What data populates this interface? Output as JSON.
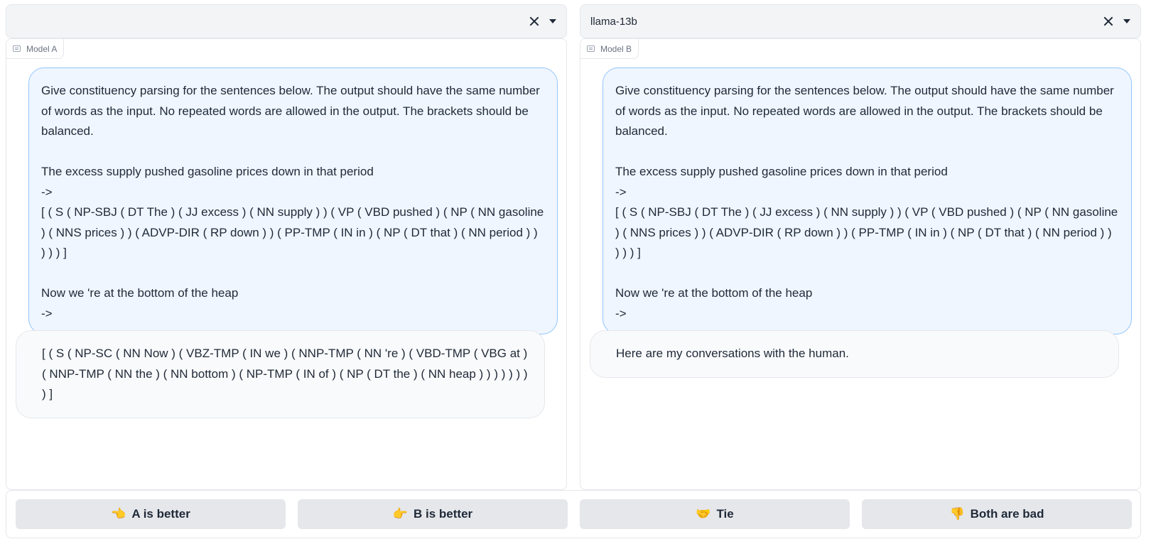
{
  "model_a": {
    "selected": ""
  },
  "model_b": {
    "selected": "llama-13b"
  },
  "panel_a": {
    "label": "Model A",
    "user_message": [
      "Give constituency parsing for the sentences below. The output should have the same number of words as the input. No repeated words are allowed in the output. The brackets should be balanced.",
      "",
      "The excess supply pushed gasoline prices down in that period",
      "->",
      "[ ( S ( NP-SBJ ( DT The ) ( JJ excess ) ( NN supply ) ) ( VP ( VBD pushed ) ( NP ( NN gasoline ) ( NNS prices ) ) ( ADVP-DIR ( RP down ) ) ( PP-TMP ( IN in ) ( NP ( DT that ) ( NN period ) ) ) ) ) ]",
      "",
      "Now we 're at the bottom of the heap",
      "->"
    ],
    "bot_message": "[ ( S ( NP-SC ( NN Now ) ( VBZ-TMP ( IN we ) ( NNP-TMP ( NN 're ) ( VBD-TMP ( VBG at ) ( NNP-TMP ( NN the ) ( NN bottom ) ( NP-TMP ( IN of ) ( NP ( DT the ) ( NN heap ) ) ) ) ) ) ) ) ]"
  },
  "panel_b": {
    "label": "Model B",
    "user_message": [
      "Give constituency parsing for the sentences below. The output should have the same number of words as the input. No repeated words are allowed in the output. The brackets should be balanced.",
      "",
      "The excess supply pushed gasoline prices down in that period",
      "->",
      "[ ( S ( NP-SBJ ( DT The ) ( JJ excess ) ( NN supply ) ) ( VP ( VBD pushed ) ( NP ( NN gasoline ) ( NNS prices ) ) ( ADVP-DIR ( RP down ) ) ( PP-TMP ( IN in ) ( NP ( DT that ) ( NN period ) ) ) ) ) ]",
      "",
      "Now we 're at the bottom of the heap",
      "->"
    ],
    "bot_message": "Here are my conversations with the human."
  },
  "votes": {
    "a_better": {
      "emoji": "👈",
      "label": "A is better"
    },
    "b_better": {
      "emoji": "👉",
      "label": "B is better"
    },
    "tie": {
      "emoji": "🤝",
      "label": "Tie"
    },
    "both_bad": {
      "emoji": "👎",
      "label": "Both are bad"
    }
  },
  "icons": {
    "clear": "close-icon",
    "dropdown": "chevron-down-icon",
    "panel": "chat-icon"
  },
  "colors": {
    "user_bubble_bg": "#eff6ff",
    "user_bubble_border": "#93c5fd",
    "bot_bubble_bg": "#f9fafb",
    "button_bg": "#e5e7eb"
  }
}
